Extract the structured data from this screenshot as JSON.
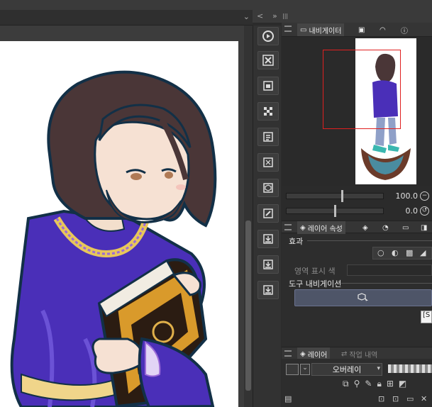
{
  "panel_strip": {
    "collapse_label": "<",
    "expand_label": "»",
    "grip_label": "|||"
  },
  "navigator": {
    "tabs": [
      {
        "label": "내비게이터"
      },
      {
        "label": ""
      },
      {
        "label": ""
      },
      {
        "label": ""
      }
    ],
    "zoom_value": "100.0",
    "rotate_value": "0.0"
  },
  "layer_property": {
    "tab_label": "레이어 속성",
    "effect_label": "효과",
    "area_color_label": "영역 표시 색",
    "tool_navigation_label": "도구 내비게이션",
    "tooltip_text": "[S"
  },
  "layer_panel": {
    "tabs": [
      {
        "label": "레이어"
      },
      {
        "label": "작업 내역"
      }
    ],
    "blend_mode": "오버레이"
  },
  "colors": {
    "accent_red": "#e02020",
    "tool_button_bg": "#4e5568"
  }
}
